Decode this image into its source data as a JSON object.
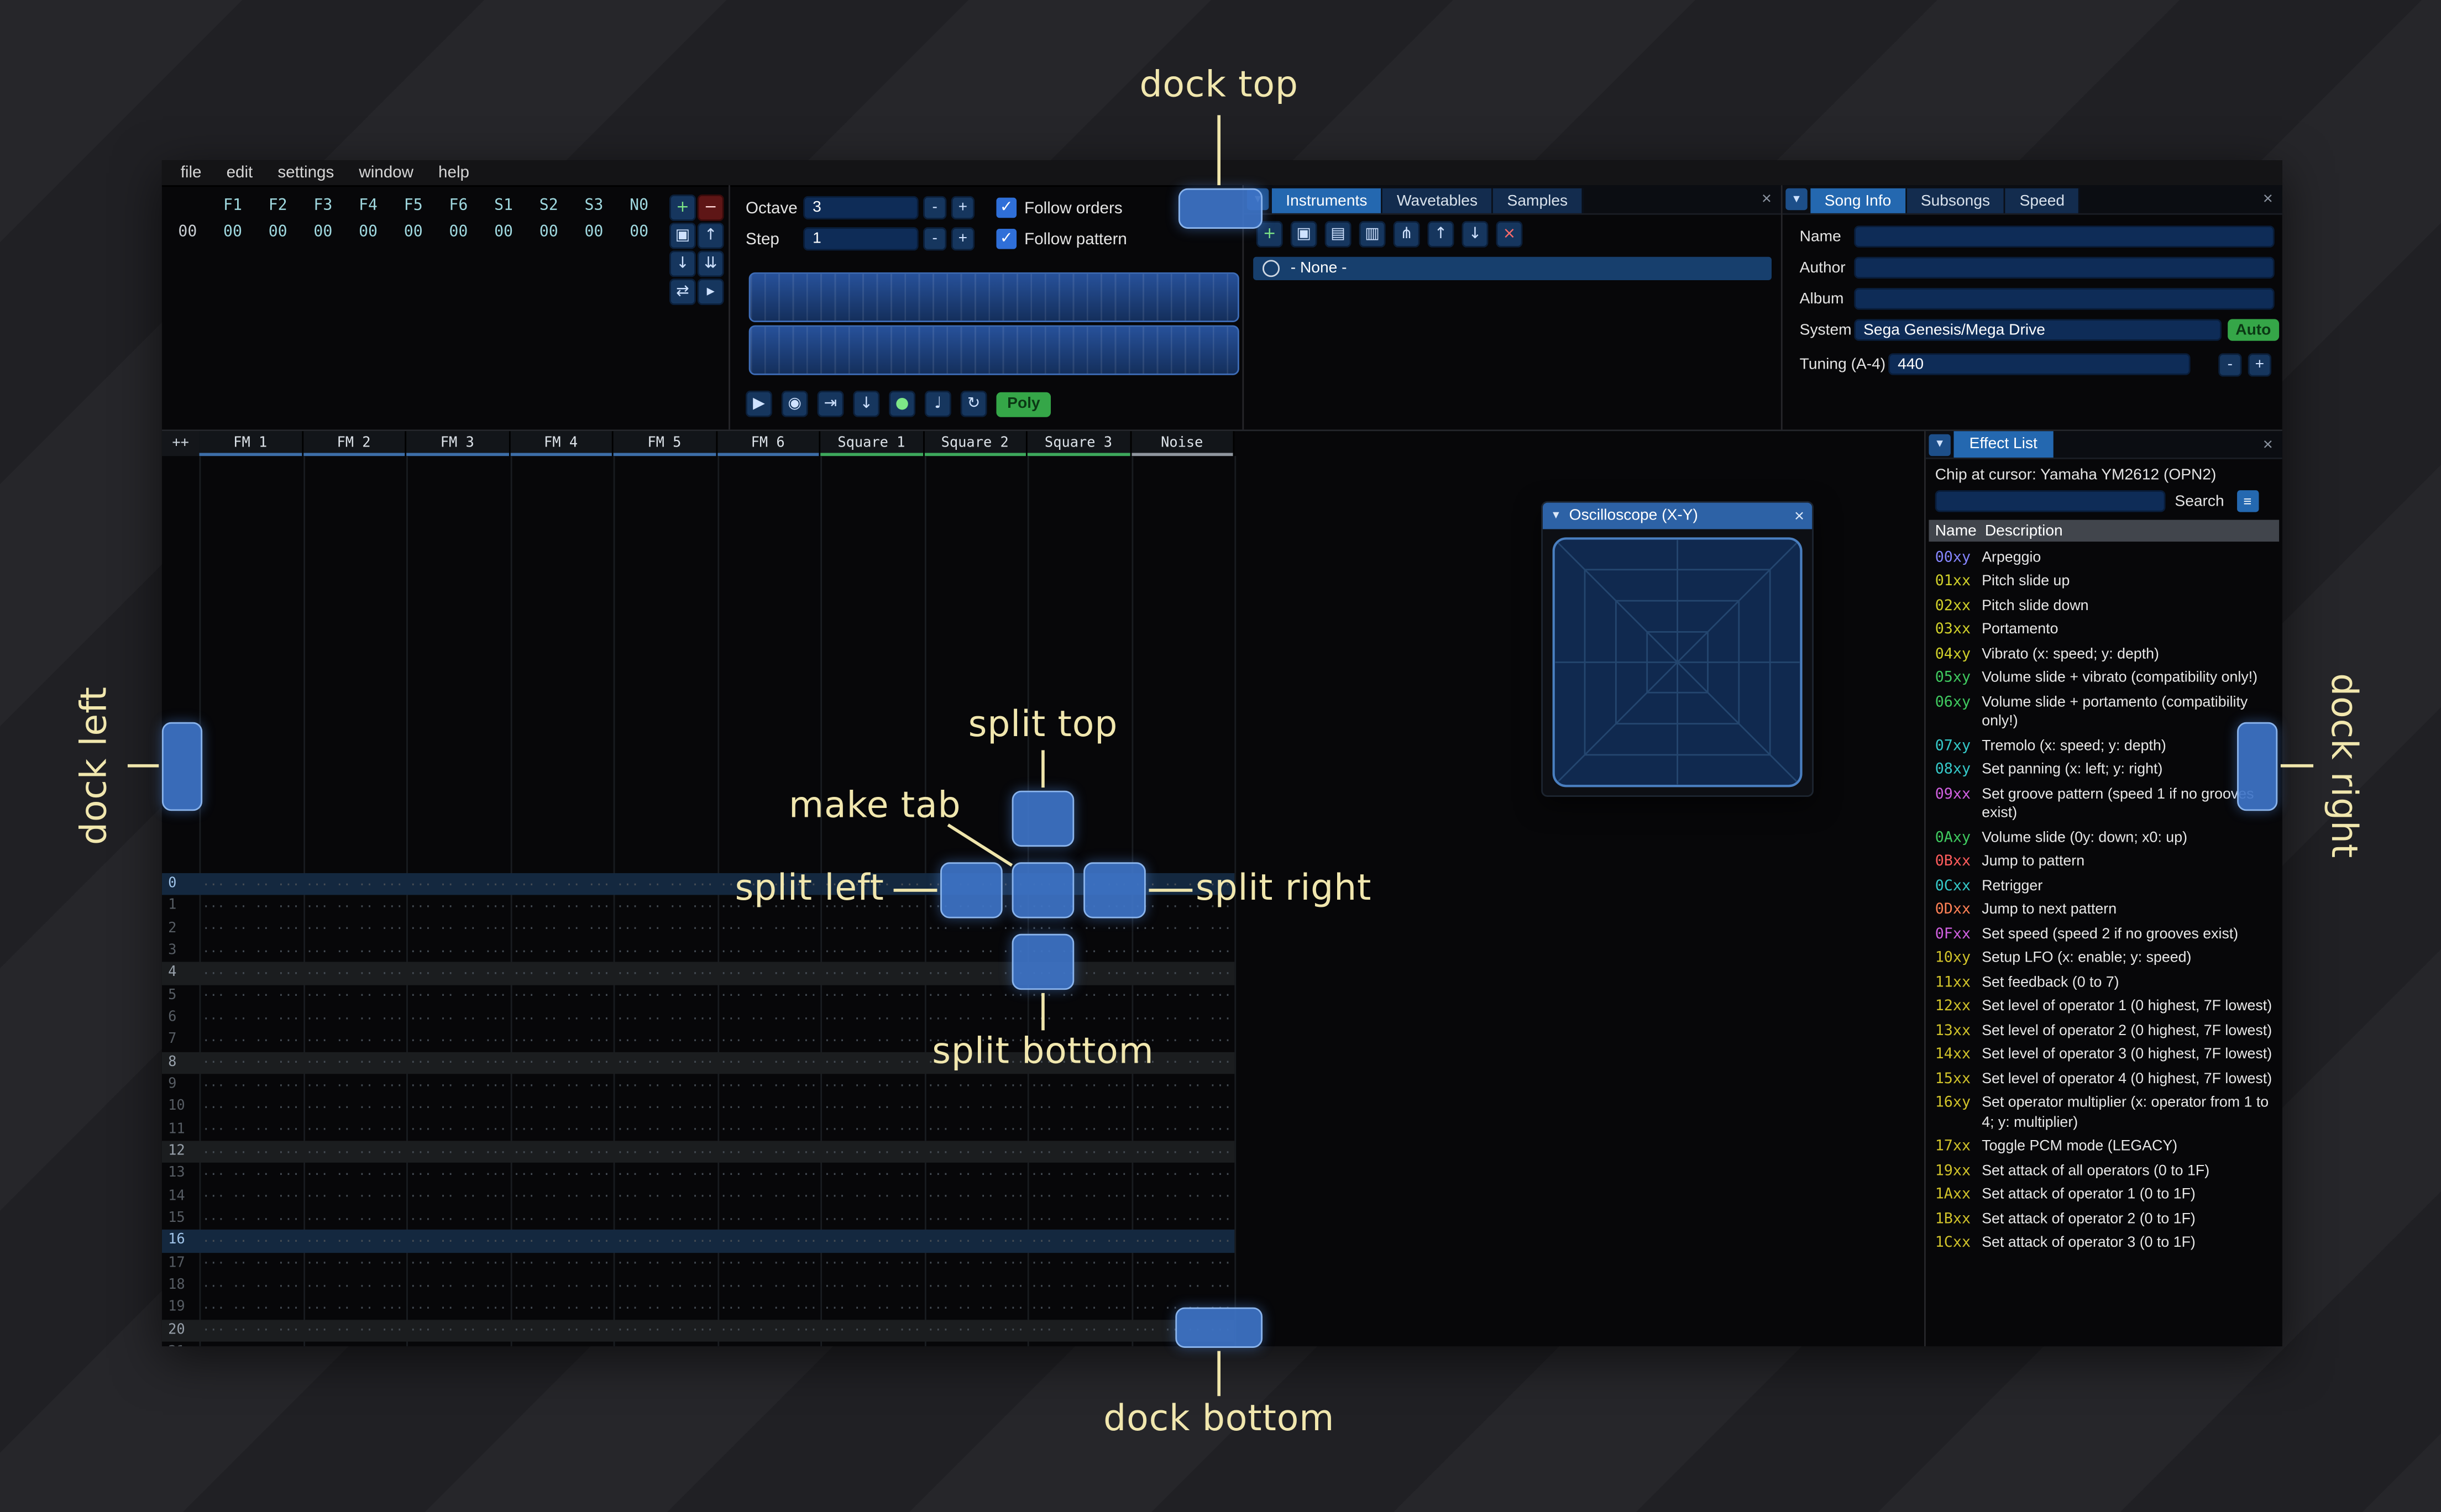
{
  "annotations": {
    "dock_top": "dock top",
    "dock_bottom": "dock bottom",
    "dock_left": "dock left",
    "dock_right": "dock right",
    "split_top": "split top",
    "split_bottom": "split bottom",
    "split_left": "split left",
    "split_right": "split right",
    "make_tab": "make tab"
  },
  "menu": {
    "items": [
      "file",
      "edit",
      "settings",
      "window",
      "help"
    ]
  },
  "orders": {
    "row_index": "00",
    "channel_headers": [
      "F1",
      "F2",
      "F3",
      "F4",
      "F5",
      "F6",
      "S1",
      "S2",
      "S3",
      "N0"
    ],
    "row_values": [
      "00",
      "00",
      "00",
      "00",
      "00",
      "00",
      "00",
      "00",
      "00",
      "00"
    ],
    "buttons": [
      {
        "name": "add-order",
        "glyph": "+",
        "style": "green-glyph"
      },
      {
        "name": "remove-order",
        "glyph": "−",
        "style": "red"
      },
      {
        "name": "duplicate-order",
        "glyph": "▣",
        "style": ""
      },
      {
        "name": "move-order-up",
        "glyph": "↑",
        "style": ""
      },
      {
        "name": "move-order-down",
        "glyph": "↓",
        "style": ""
      },
      {
        "name": "duplicate-order-end",
        "glyph": "⇊",
        "style": ""
      },
      {
        "name": "order-change-mode",
        "glyph": "⇄",
        "style": ""
      },
      {
        "name": "order-edit-mode",
        "glyph": "▸",
        "style": ""
      }
    ]
  },
  "transport": {
    "octave": {
      "label": "Octave",
      "value": "3"
    },
    "step": {
      "label": "Step",
      "value": "1"
    },
    "follow_orders": "Follow orders",
    "follow_pattern": "Follow pattern",
    "check_glyph": "✓",
    "minus": "-",
    "plus": "+",
    "buttons": [
      {
        "name": "play",
        "glyph": "▶",
        "style": ""
      },
      {
        "name": "play-repeat",
        "glyph": "◉",
        "style": ""
      },
      {
        "name": "play-from-cursor",
        "glyph": "⇥",
        "style": ""
      },
      {
        "name": "step-one-row",
        "glyph": "↓",
        "style": ""
      },
      {
        "name": "edit-toggle",
        "glyph": "●",
        "style": "green-glyph"
      },
      {
        "name": "metronome",
        "glyph": "♩",
        "style": ""
      },
      {
        "name": "repeat-pattern",
        "glyph": "↻",
        "style": ""
      }
    ],
    "poly_label": "Poly"
  },
  "instruments": {
    "tabs": [
      {
        "label": "Instruments",
        "active": true
      },
      {
        "label": "Wavetables",
        "active": false
      },
      {
        "label": "Samples",
        "active": false
      }
    ],
    "toolbar": [
      {
        "name": "add-instrument",
        "glyph": "+",
        "style": "green-glyph"
      },
      {
        "name": "duplicate-instrument",
        "glyph": "▣",
        "style": ""
      },
      {
        "name": "open-instrument",
        "glyph": "▤",
        "style": ""
      },
      {
        "name": "save-instrument",
        "glyph": "▥",
        "style": ""
      },
      {
        "name": "instrument-folders",
        "glyph": "⋔",
        "style": ""
      },
      {
        "name": "move-instrument-up",
        "glyph": "↑",
        "style": ""
      },
      {
        "name": "move-instrument-down",
        "glyph": "↓",
        "style": ""
      },
      {
        "name": "delete-instrument",
        "glyph": "×",
        "style": "red-glyph"
      }
    ],
    "list": [
      {
        "label": "- None -",
        "selected": true
      }
    ]
  },
  "song_info": {
    "tabs": [
      {
        "label": "Song Info",
        "active": true
      },
      {
        "label": "Subsongs",
        "active": false
      },
      {
        "label": "Speed",
        "active": false
      }
    ],
    "name_label": "Name",
    "name_value": "",
    "author_label": "Author",
    "author_value": "",
    "album_label": "Album",
    "album_value": "",
    "system_label": "System",
    "system_value": "Sega Genesis/Mega Drive",
    "auto_label": "Auto",
    "tuning_label": "Tuning (A-4)",
    "tuning_value": "440",
    "minus": "-",
    "plus": "+"
  },
  "pattern": {
    "corner_label": "++",
    "channels": [
      {
        "name": "FM 1",
        "color": "#3d6ea8"
      },
      {
        "name": "FM 2",
        "color": "#3d6ea8"
      },
      {
        "name": "FM 3",
        "color": "#3d6ea8"
      },
      {
        "name": "FM 4",
        "color": "#3d6ea8"
      },
      {
        "name": "FM 5",
        "color": "#3d6ea8"
      },
      {
        "name": "FM 6",
        "color": "#3d6ea8"
      },
      {
        "name": "Square 1",
        "color": "#3da85c"
      },
      {
        "name": "Square 2",
        "color": "#3da85c"
      },
      {
        "name": "Square 3",
        "color": "#3da85c"
      },
      {
        "name": "Noise",
        "color": "#8f969e"
      }
    ],
    "rows": 22,
    "highlight1_rows": [
      4,
      8,
      12,
      20
    ],
    "highlight2_rows": [
      0,
      16
    ],
    "empty_cell": "··· ·· ·· ···"
  },
  "oscilloscope": {
    "title": "Oscilloscope (X-Y)"
  },
  "effect_list": {
    "tab_label": "Effect List",
    "chip_line": "Chip at cursor: Yamaha YM2612 (OPN2)",
    "search_label": "Search",
    "search_value": "",
    "name_col": "Name",
    "desc_col": "Description",
    "effects": [
      {
        "code": "00xy",
        "color": "#8585ff",
        "desc": "Arpeggio"
      },
      {
        "code": "01xx",
        "color": "#d0d02a",
        "desc": "Pitch slide up"
      },
      {
        "code": "02xx",
        "color": "#d0d02a",
        "desc": "Pitch slide down"
      },
      {
        "code": "03xx",
        "color": "#d0d02a",
        "desc": "Portamento"
      },
      {
        "code": "04xy",
        "color": "#d0d02a",
        "desc": "Vibrato (x: speed; y: depth)"
      },
      {
        "code": "05xy",
        "color": "#3fc95f",
        "desc": "Volume slide + vibrato (compatibility only!)"
      },
      {
        "code": "06xy",
        "color": "#3fc95f",
        "desc": "Volume slide + portamento (compatibility only!)"
      },
      {
        "code": "07xy",
        "color": "#35c9c9",
        "desc": "Tremolo (x: speed; y: depth)"
      },
      {
        "code": "08xy",
        "color": "#35c9c9",
        "desc": "Set panning (x: left; y: right)"
      },
      {
        "code": "09xx",
        "color": "#d060e0",
        "desc": "Set groove pattern (speed 1 if no grooves exist)"
      },
      {
        "code": "0Axy",
        "color": "#3fc95f",
        "desc": "Volume slide (0y: down; x0: up)"
      },
      {
        "code": "0Bxx",
        "color": "#ff5c5c",
        "desc": "Jump to pattern"
      },
      {
        "code": "0Cxx",
        "color": "#35c9c9",
        "desc": "Retrigger"
      },
      {
        "code": "0Dxx",
        "color": "#ff8055",
        "desc": "Jump to next pattern"
      },
      {
        "code": "0Fxx",
        "color": "#d060e0",
        "desc": "Set speed (speed 2 if no grooves exist)"
      },
      {
        "code": "10xy",
        "color": "#d0c22a",
        "desc": "Setup LFO (x: enable; y: speed)"
      },
      {
        "code": "11xx",
        "color": "#d0c22a",
        "desc": "Set feedback (0 to 7)"
      },
      {
        "code": "12xx",
        "color": "#d0c22a",
        "desc": "Set level of operator 1 (0 highest, 7F lowest)"
      },
      {
        "code": "13xx",
        "color": "#d0c22a",
        "desc": "Set level of operator 2 (0 highest, 7F lowest)"
      },
      {
        "code": "14xx",
        "color": "#d0c22a",
        "desc": "Set level of operator 3 (0 highest, 7F lowest)"
      },
      {
        "code": "15xx",
        "color": "#d0c22a",
        "desc": "Set level of operator 4 (0 highest, 7F lowest)"
      },
      {
        "code": "16xy",
        "color": "#d0c22a",
        "desc": "Set operator multiplier (x: operator from 1 to 4; y: multiplier)"
      },
      {
        "code": "17xx",
        "color": "#d0c22a",
        "desc": "Toggle PCM mode (LEGACY)"
      },
      {
        "code": "19xx",
        "color": "#d0c22a",
        "desc": "Set attack of all operators (0 to 1F)"
      },
      {
        "code": "1Axx",
        "color": "#d0c22a",
        "desc": "Set attack of operator 1 (0 to 1F)"
      },
      {
        "code": "1Bxx",
        "color": "#d0c22a",
        "desc": "Set attack of operator 2 (0 to 1F)"
      },
      {
        "code": "1Cxx",
        "color": "#d0c22a",
        "desc": "Set attack of operator 3 (0 to 1F)"
      }
    ]
  }
}
